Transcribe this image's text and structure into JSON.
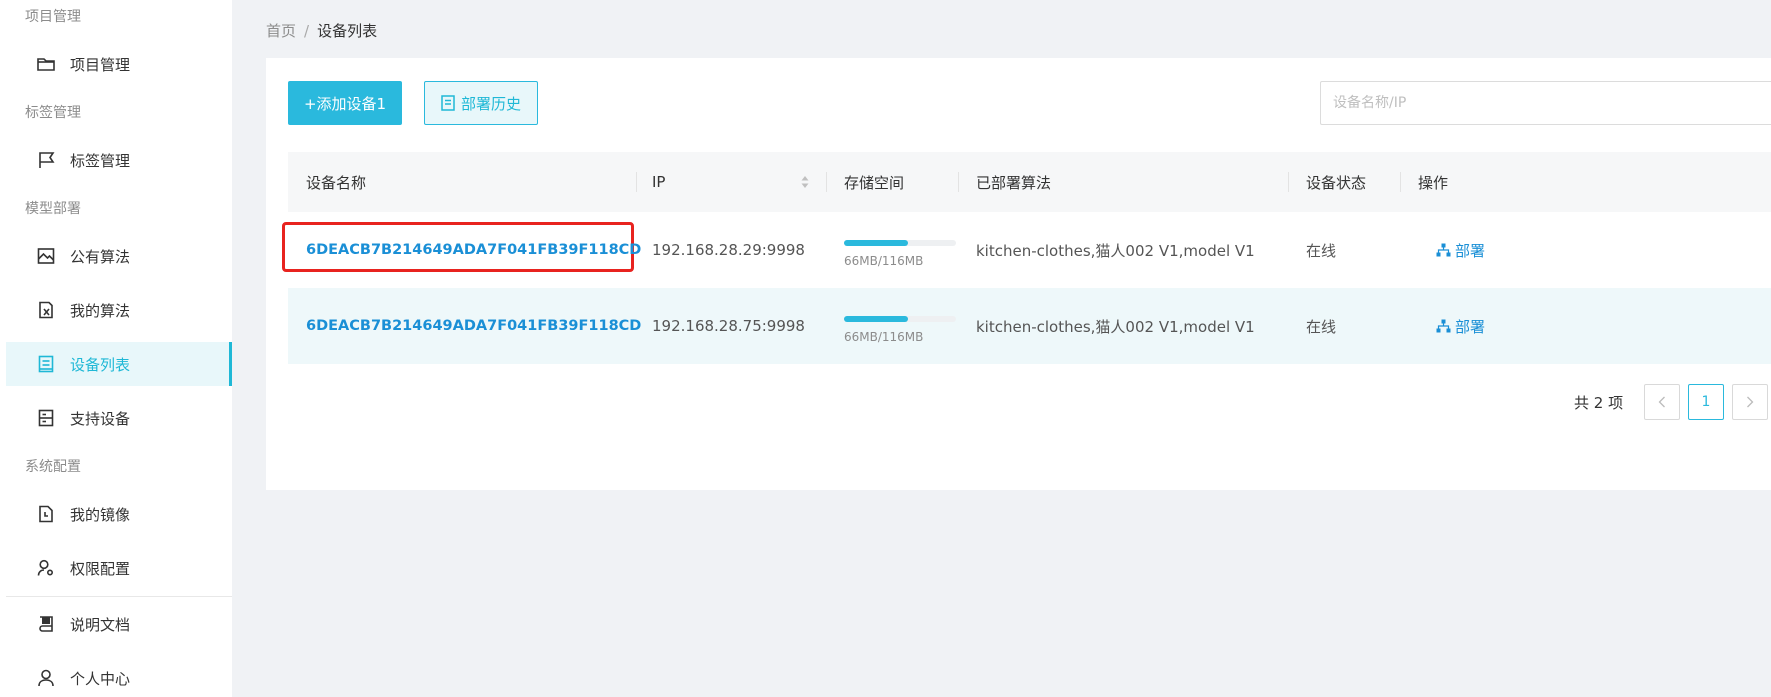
{
  "sidebar": {
    "groups": [
      {
        "title": "项目管理",
        "items": [
          {
            "label": "项目管理",
            "icon": "folder-icon"
          }
        ]
      },
      {
        "title": "标签管理",
        "items": [
          {
            "label": "标签管理",
            "icon": "flag-icon"
          }
        ]
      },
      {
        "title": "模型部署",
        "items": [
          {
            "label": "公有算法",
            "icon": "image-frame-icon"
          },
          {
            "label": "我的算法",
            "icon": "doc-algorithm-icon"
          },
          {
            "label": "设备列表",
            "icon": "device-list-icon"
          },
          {
            "label": "支持设备",
            "icon": "server-icon"
          }
        ]
      },
      {
        "title": "系统配置",
        "items": [
          {
            "label": "我的镜像",
            "icon": "mirror-icon"
          },
          {
            "label": "权限配置",
            "icon": "user-gear-icon"
          }
        ]
      }
    ],
    "bottom_items": [
      {
        "label": "说明文档",
        "icon": "book-icon"
      },
      {
        "label": "个人中心",
        "icon": "user-icon"
      }
    ],
    "active": "设备列表"
  },
  "breadcrumb": {
    "home": "首页",
    "separator": "/",
    "current": "设备列表"
  },
  "toolbar": {
    "add_button": "+添加设备1",
    "history_button": "部署历史",
    "search_placeholder": "设备名称/IP"
  },
  "table": {
    "columns": [
      "设备名称",
      "IP",
      "存储空间",
      "已部署算法",
      "设备状态",
      "操作"
    ],
    "rows": [
      {
        "name": "6DEACB7B214649ADA7F041FB39F118CD",
        "ip": "192.168.28.29:9998",
        "storage_text": "66MB/116MB",
        "storage_used": 66,
        "storage_total": 116,
        "algorithms": "kitchen-clothes,猫人002 V1,model V1",
        "status": "在线",
        "action": "部署"
      },
      {
        "name": "6DEACB7B214649ADA7F041FB39F118CD",
        "ip": "192.168.28.75:9998",
        "storage_text": "66MB/116MB",
        "storage_used": 66,
        "storage_total": 116,
        "algorithms": "kitchen-clothes,猫人002 V1,model V1",
        "status": "在线",
        "action": "部署"
      }
    ]
  },
  "pagination": {
    "total_text": "共 2 项",
    "current_page": "1"
  },
  "colors": {
    "accent": "#2ab9dd",
    "link": "#1a8fd6",
    "highlight": "#e8231f"
  }
}
